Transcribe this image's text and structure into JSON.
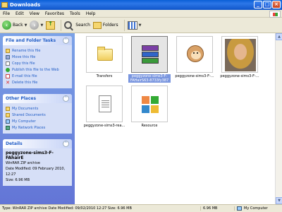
{
  "window": {
    "title": "Downloads"
  },
  "menu": [
    "File",
    "Edit",
    "View",
    "Favorites",
    "Tools",
    "Help"
  ],
  "toolbar": {
    "back_label": "Back",
    "search_label": "Search",
    "folders_label": "Folders"
  },
  "sidebar": {
    "tasks": {
      "title": "File and Folder Tasks",
      "items": [
        {
          "label": "Rename this file",
          "icon": "rename-icon"
        },
        {
          "label": "Move this file",
          "icon": "move-icon"
        },
        {
          "label": "Copy this file",
          "icon": "copy-icon"
        },
        {
          "label": "Publish this file to the Web",
          "icon": "globe-icon"
        },
        {
          "label": "E-mail this file",
          "icon": "mail-icon"
        },
        {
          "label": "Delete this file",
          "icon": "delete-icon"
        }
      ]
    },
    "places": {
      "title": "Other Places",
      "items": [
        {
          "label": "My Documents",
          "icon": "folder-icon"
        },
        {
          "label": "Shared Documents",
          "icon": "folder-icon"
        },
        {
          "label": "My Computer",
          "icon": "computer-icon"
        },
        {
          "label": "My Network Places",
          "icon": "network-icon"
        }
      ]
    },
    "details": {
      "title": "Details",
      "name": "peggyzone-sims3-F-FAhairE",
      "type": "WinRAR ZIP archive",
      "modified": "Date Modified: 09 February 2010, 12:27",
      "size": "Size: 6.96 MB"
    }
  },
  "files": [
    {
      "name": "Transfers",
      "kind": "folder",
      "selected": false
    },
    {
      "name": "peggyzone-sims3-F-FAHairS63-8733fy387",
      "kind": "rar",
      "selected": true
    },
    {
      "name": "peggyzone-sims3-F-...",
      "kind": "monkey",
      "selected": false
    },
    {
      "name": "peggyzone-sims3-F-...",
      "kind": "portrait",
      "selected": false
    },
    {
      "name": "peggyzone-sims3-rea...",
      "kind": "text",
      "selected": false
    },
    {
      "name": "Resource",
      "kind": "resource",
      "selected": false
    }
  ],
  "status": {
    "text": "Type: WinRAR ZIP archive Date Modified: 09/02/2010 12:27 Size: 6.96 MB",
    "size": "6.96 MB",
    "location": "My Computer"
  },
  "colors": {
    "titlebar": "#0a5fd6",
    "sidebar": "#6375d6",
    "selection": "#7a96df"
  }
}
